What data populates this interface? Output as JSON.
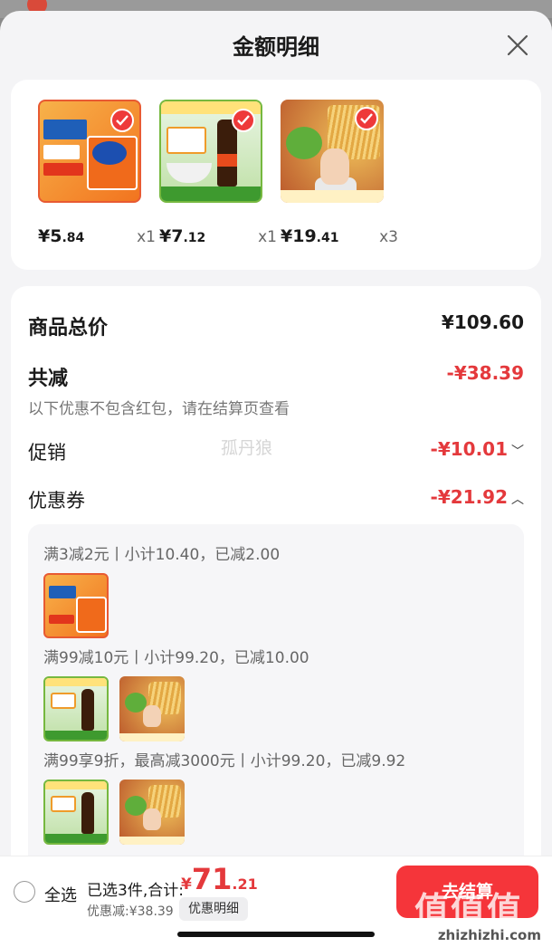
{
  "sheet": {
    "title": "金额明细"
  },
  "products": [
    {
      "price_int": "¥5",
      "price_dec": ".84",
      "qty": "x1",
      "art": "detergent"
    },
    {
      "price_int": "¥7",
      "price_dec": ".12",
      "qty": "x1",
      "art": "sauce"
    },
    {
      "price_int": "¥19",
      "price_dec": ".41",
      "qty": "x3",
      "art": "noodle"
    }
  ],
  "summary": {
    "subtotal_label": "商品总价",
    "subtotal_value": "¥109.60",
    "total_discount_label": "共减",
    "total_discount_value": "-¥38.39",
    "note": "以下优惠不包含红包，请在结算页查看",
    "promo_label": "促销",
    "promo_value": "-¥10.01",
    "coupon_label": "优惠券",
    "coupon_value": "-¥21.92"
  },
  "watermark": "孤丹狼",
  "coupons": [
    {
      "text": "满3减2元丨小计10.40，已减2.00"
    },
    {
      "text": "满99减10元丨小计99.20，已减10.00"
    },
    {
      "text": "满99享9折，最高减3000元丨小计99.20，已减9.92"
    }
  ],
  "bottom_bar": {
    "select_all": "全选",
    "selected_text": "已选3件,合计:",
    "total_symbol": "¥",
    "total_int": "71",
    "total_dec": ".21",
    "discount_text": "优惠减:¥38.39",
    "detail_button": "优惠明细",
    "checkout_button": "去结算",
    "site_mark": "值值值",
    "site_url": "zhizhizhi.com"
  },
  "colors": {
    "accent": "#e4393c",
    "checkout": "#f5353a"
  }
}
